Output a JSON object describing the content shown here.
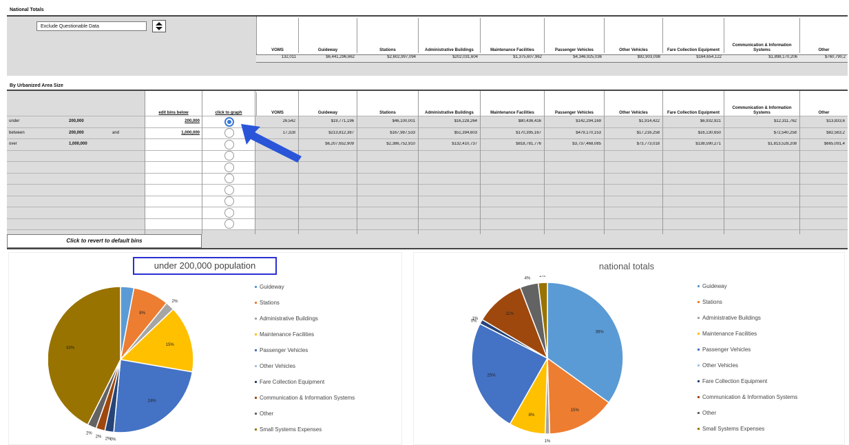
{
  "national": {
    "title": "National Totals",
    "dropdown_value": "Exclude Questionable Data",
    "columns": [
      "VOMS",
      "Guideway",
      "Stations",
      "Administrative Buildings",
      "Maintenance Facilities",
      "Passenger Vehicles",
      "Other Vehicles",
      "Fare Collection Equipment",
      "Communication & Information Systems",
      "Other"
    ],
    "values": [
      "132,011",
      "$6,441,296,662",
      "$2,602,997,094",
      "$202,031,604",
      "$1,375,607,962",
      "$4,346,925,036",
      "$92,903,098",
      "$164,654,122",
      "$1,898,170,206",
      "$760,790,2"
    ]
  },
  "by_area": {
    "title": "By Urbanized Area Size",
    "edit_bins_header": "edit bins below",
    "click_graph_header": "click to graph",
    "rows": [
      {
        "label1": "under",
        "value1": "200,000",
        "label2": "",
        "bin": "200,000",
        "selected": true,
        "cells": [
          "26,542",
          "$19,771,196",
          "$46,100,001",
          "$16,228,264",
          "$80,436,416",
          "$142,294,169",
          "$1,914,422",
          "$6,932,921",
          "$12,311,762",
          "$13,833,6"
        ]
      },
      {
        "label1": "between",
        "value1": "200,000",
        "label2": "and",
        "bin": "1,000,000",
        "selected": false,
        "cells": [
          "17,328",
          "$213,812,387",
          "$167,987,533",
          "$51,394,603",
          "$170,395,167",
          "$479,170,153",
          "$17,216,258",
          "$16,130,650",
          "$72,540,258",
          "$82,563,2"
        ]
      },
      {
        "label1": "over",
        "value1": "1,000,000",
        "label2": "",
        "bin": "",
        "selected": false,
        "cells": [
          "",
          "$6,207,652,909",
          "$2,386,752,910",
          "$132,410,737",
          "$818,781,776",
          "$3,737,468,085",
          "$73,773,018",
          "$138,590,271",
          "$1,813,528,208",
          "$665,091,4"
        ]
      }
    ],
    "revert_label": "Click to revert to default bins"
  },
  "chart_data": [
    {
      "type": "pie",
      "title": "under 200,000 population",
      "categories": [
        "Guideway",
        "Stations",
        "Administrative Buildings",
        "Maintenance Facilities",
        "Passenger Vehicles",
        "Other Vehicles",
        "Fare Collection Equipment",
        "Communication & Information Systems",
        "Other",
        "Small Systems Expenses"
      ],
      "values": [
        3,
        8,
        2,
        15,
        24,
        0,
        2,
        2,
        2,
        43
      ],
      "labels": [
        "3%",
        "8%",
        "2%",
        "15%",
        "24%",
        "0%",
        "2%",
        "2%",
        "2%",
        "43%"
      ],
      "colors": [
        "#5b9bd5",
        "#ed7d31",
        "#a5a5a5",
        "#ffc000",
        "#4472c4",
        "#9dc3e6",
        "#264478",
        "#9e480e",
        "#636363",
        "#997300"
      ],
      "legend": "right"
    },
    {
      "type": "pie",
      "title": "national totals",
      "categories": [
        "Guideway",
        "Stations",
        "Administrative Buildings",
        "Maintenance Facilities",
        "Passenger Vehicles",
        "Other Vehicles",
        "Fare Collection Equipment",
        "Communication & Information Systems",
        "Other",
        "Small Systems Expenses"
      ],
      "values": [
        36,
        15,
        1,
        8,
        25,
        0,
        1,
        11,
        4,
        2
      ],
      "labels": [
        "36%",
        "15%",
        "1%",
        "8%",
        "25%",
        "0%",
        "1%",
        "11%",
        "4%",
        "2%"
      ],
      "colors": [
        "#5b9bd5",
        "#ed7d31",
        "#a5a5a5",
        "#ffc000",
        "#4472c4",
        "#9dc3e6",
        "#264478",
        "#9e480e",
        "#636363",
        "#997300"
      ],
      "legend": "right"
    }
  ]
}
